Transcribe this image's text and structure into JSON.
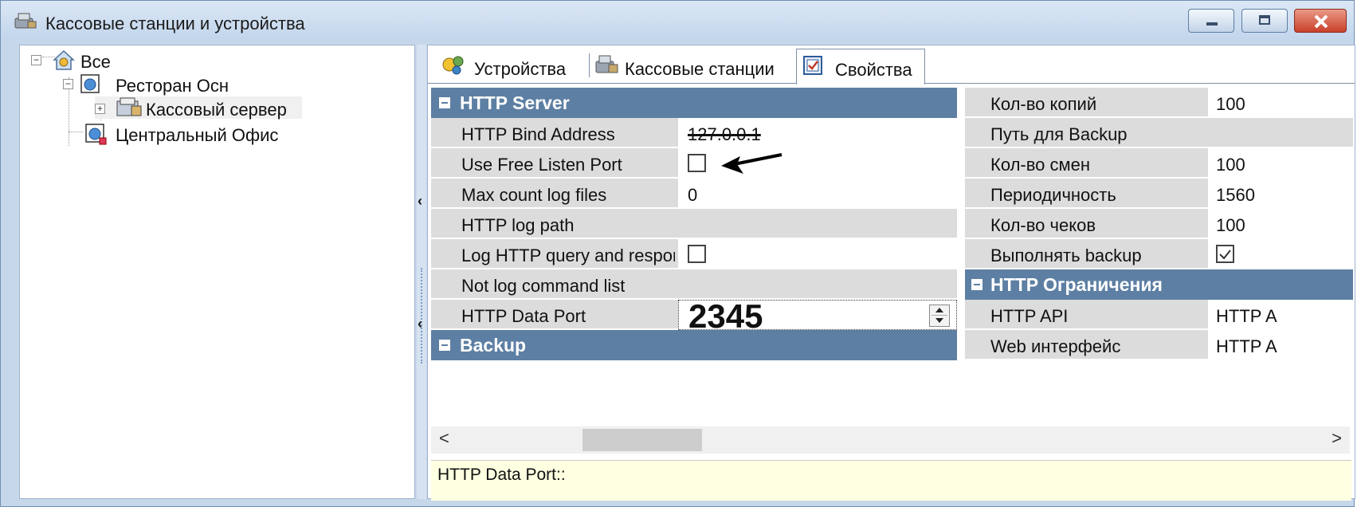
{
  "window": {
    "title": "Кассовые станции и устройства"
  },
  "tree": {
    "items": [
      {
        "label": "Все"
      },
      {
        "label": "Ресторан Осн"
      },
      {
        "label": "Кассовый сервер"
      },
      {
        "label": "Центральный Офис"
      }
    ]
  },
  "tabs": [
    {
      "label": "Устройства"
    },
    {
      "label": "Кассовые станции"
    },
    {
      "label": "Свойства",
      "active": true
    }
  ],
  "grid_left": {
    "category_http": "HTTP Server",
    "rows": [
      {
        "name": "HTTP Bind Address",
        "value": "127.0.0.1"
      },
      {
        "name": "Use Free Listen Port",
        "checked": false
      },
      {
        "name": "Max count log files",
        "value": "0"
      },
      {
        "name": "HTTP log path",
        "value": ""
      },
      {
        "name": "Log HTTP query and respons",
        "checked": false
      },
      {
        "name": "Not log command list",
        "value": ""
      },
      {
        "name": "HTTP Data Port",
        "value": "2345"
      }
    ],
    "category_backup": "Backup"
  },
  "grid_right": {
    "rows": [
      {
        "name": "Кол-во копий",
        "value": "100"
      },
      {
        "name": "Путь для Backup",
        "value": ""
      },
      {
        "name": "Кол-во смен",
        "value": "100"
      },
      {
        "name": "Периодичность",
        "value": "1560"
      },
      {
        "name": "Кол-во чеков",
        "value": "100"
      },
      {
        "name": "Выполнять backup",
        "checked": true
      }
    ],
    "category_limits": "HTTP Ограничения",
    "limit_rows": [
      {
        "name": "HTTP API",
        "value": "HTTP A"
      },
      {
        "name": "Web интерфейс",
        "value": "HTTP A"
      }
    ]
  },
  "description": {
    "text": "HTTP Data Port::"
  },
  "scroll": {
    "left": "<",
    "right": ">"
  },
  "colors": {
    "category_bg": "#5d7fa3",
    "name_cell_bg": "#dcdcdc",
    "description_bg": "#ffffe1"
  }
}
